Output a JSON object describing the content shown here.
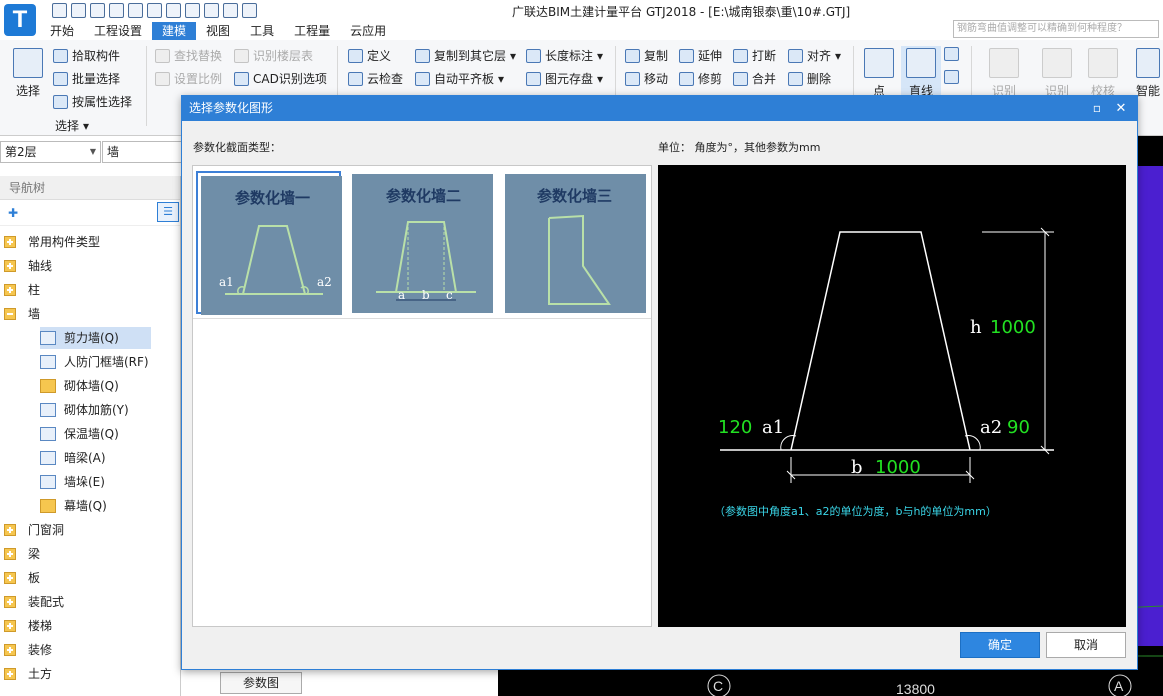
{
  "app": {
    "logo_letter": "T",
    "title": "广联达BIM土建计量平台 GTJ2018 - [E:\\城南银泰\\重\\10#.GTJ]",
    "help_placeholder": "钢筋弯曲值调整可以精确到何种程度？"
  },
  "menu_tabs": [
    "开始",
    "工程设置",
    "建模",
    "视图",
    "工具",
    "工程量",
    "云应用"
  ],
  "active_tab": "建模",
  "ribbon": {
    "select_big": "选择",
    "pick_component": "拾取构件",
    "batch_select": "批量选择",
    "select_by_attr": "按属性选择",
    "select_group": "选择",
    "find_replace": "查找替换",
    "set_ratio": "设置比例",
    "identify_floor_table": "识别楼层表",
    "cad_options": "CAD识别选项",
    "define": "定义",
    "cloud_check": "云检查",
    "copy_to_other_floor": "复制到其它层",
    "auto_flat_slab": "自动平齐板",
    "length_dimension": "长度标注",
    "element_storage": "图元存盘",
    "copy": "复制",
    "extend": "延伸",
    "break": "打断",
    "align": "对齐",
    "move": "移动",
    "trim": "修剪",
    "merge": "合并",
    "delete": "删除",
    "point": "点",
    "line": "直线",
    "identify1": "识别",
    "identify2": "识别",
    "verify": "校核",
    "smart": "智能"
  },
  "left": {
    "floor": "第2层",
    "component_type": "墙",
    "nav_title": "导航树",
    "tree": [
      {
        "label": "常用构件类型",
        "level": 0
      },
      {
        "label": "轴线",
        "level": 0
      },
      {
        "label": "柱",
        "level": 0
      },
      {
        "label": "墙",
        "level": 0,
        "expanded": true
      },
      {
        "label": "剪力墙(Q)",
        "level": 1,
        "selected": true
      },
      {
        "label": "人防门框墙(RF)",
        "level": 1
      },
      {
        "label": "砌体墙(Q)",
        "level": 1
      },
      {
        "label": "砌体加筋(Y)",
        "level": 1
      },
      {
        "label": "保温墙(Q)",
        "level": 1
      },
      {
        "label": "暗梁(A)",
        "level": 1
      },
      {
        "label": "墙垛(E)",
        "level": 1
      },
      {
        "label": "幕墙(Q)",
        "level": 1
      },
      {
        "label": "门窗洞",
        "level": 0
      },
      {
        "label": "梁",
        "level": 0
      },
      {
        "label": "板",
        "level": 0
      },
      {
        "label": "装配式",
        "level": 0
      },
      {
        "label": "楼梯",
        "level": 0
      },
      {
        "label": "装修",
        "level": 0
      },
      {
        "label": "土方",
        "level": 0
      }
    ],
    "param_tab": "参数图"
  },
  "canvas": {
    "axis_labels": [
      "C",
      "A"
    ],
    "dimension_text": "13800"
  },
  "dialog": {
    "title": "选择参数化图形",
    "section_label": "参数化截面类型：",
    "unit_label": "单位：  角度为°，其他参数为mm",
    "thumbnails": [
      {
        "title": "参数化墙一",
        "label_left": "a1",
        "label_right": "a2"
      },
      {
        "title": "参数化墙二",
        "label_a": "a",
        "label_b": "b",
        "label_c": "c"
      },
      {
        "title": "参数化墙三"
      }
    ],
    "preview": {
      "h_label": "h",
      "h_value": "1000",
      "a1_label": "a1",
      "a1_value": "120",
      "a2_label": "a2",
      "a2_value": "90",
      "b_label": "b",
      "b_value": "1000",
      "note": "（参数图中角度a1、a2的单位为度，b与h的单位为mm）"
    },
    "ok_label": "确定",
    "cancel_label": "取消"
  }
}
